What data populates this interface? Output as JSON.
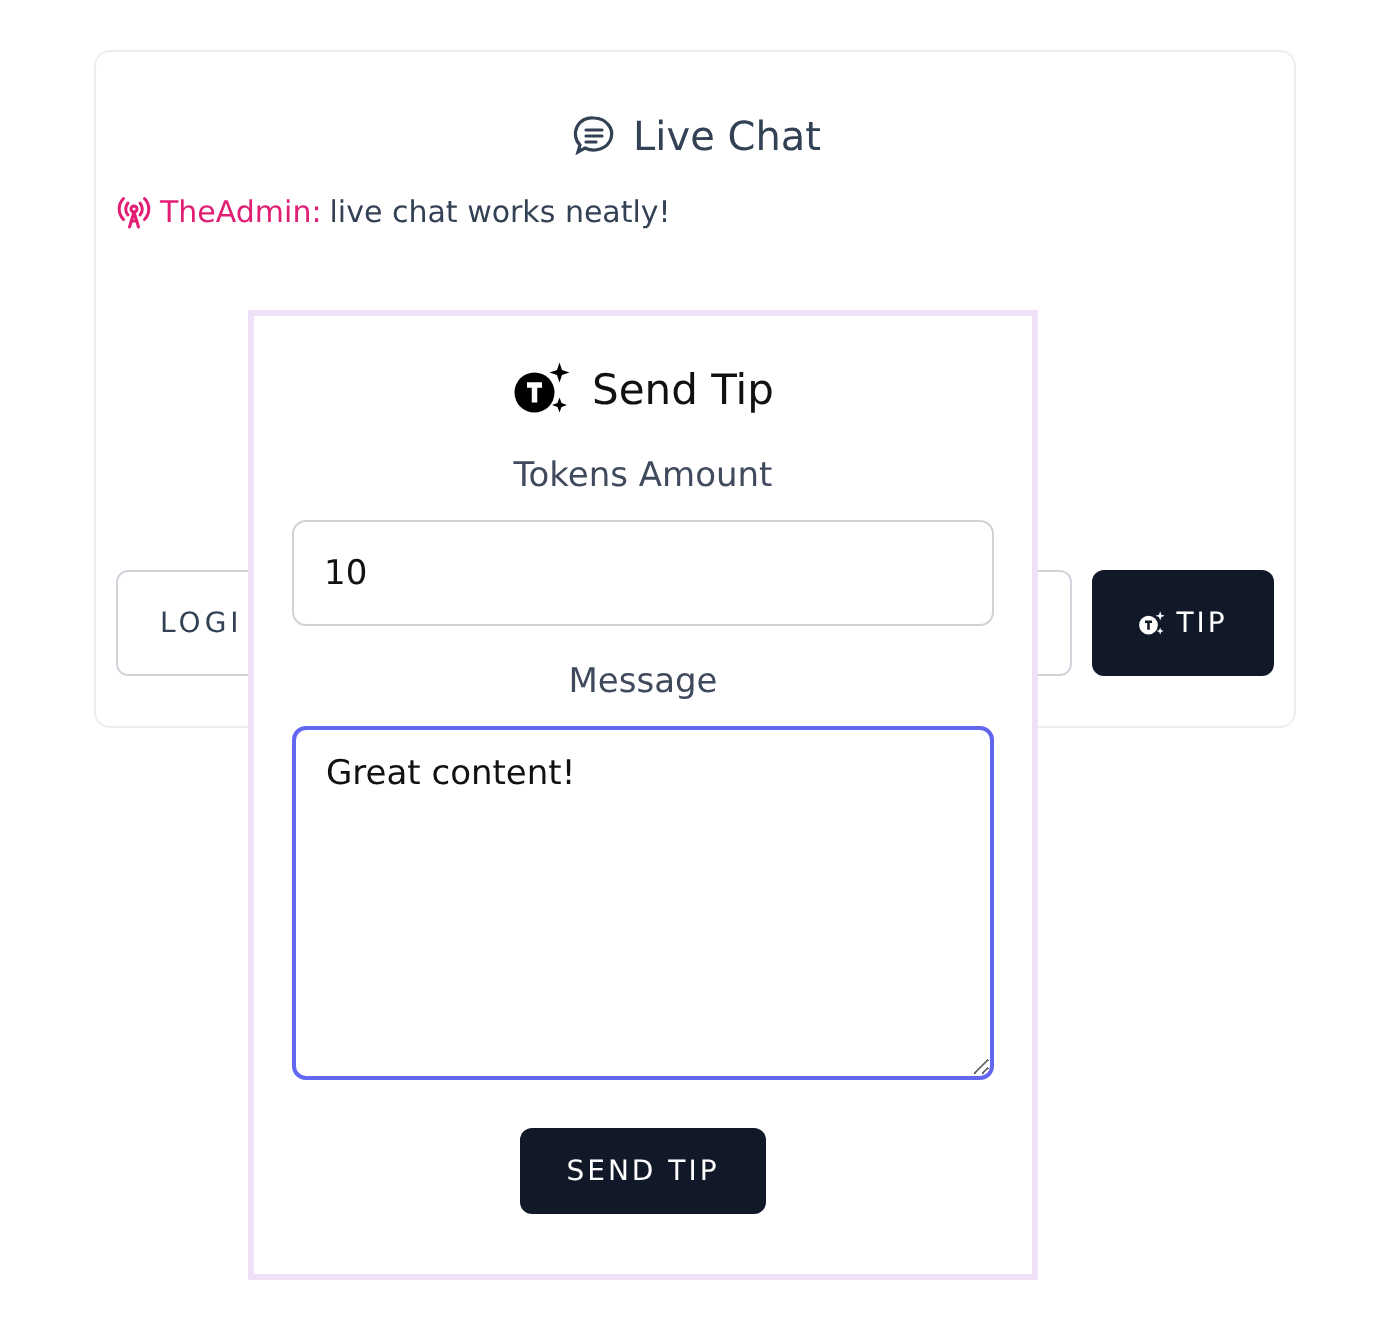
{
  "chat": {
    "title": "Live Chat",
    "messages": [
      {
        "user": "TheAdmin:",
        "text": "live chat works neatly!"
      }
    ],
    "login_button": "LOGI",
    "tip_button": "TIP"
  },
  "tip_dialog": {
    "title": "Send Tip",
    "amount_label": "Tokens Amount",
    "amount_value": "10",
    "message_label": "Message",
    "message_value": "Great content!",
    "submit_button": "SEND TIP"
  }
}
